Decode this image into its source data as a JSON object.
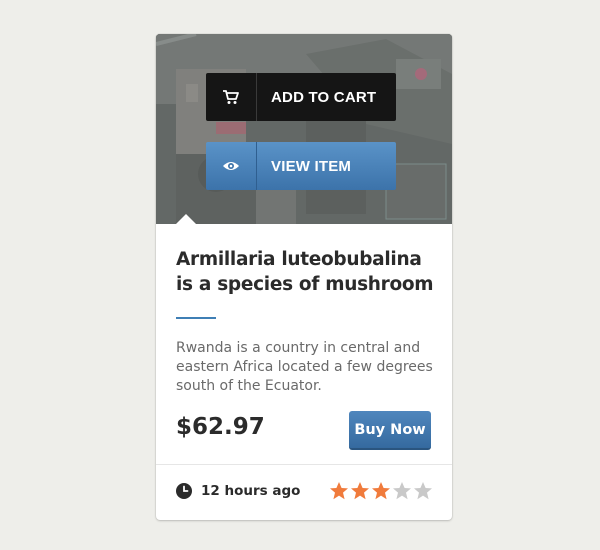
{
  "overlay_buttons": {
    "add_to_cart": {
      "label": "ADD TO CART",
      "icon": "cart-icon"
    },
    "view_item": {
      "label": "VIEW ITEM",
      "icon": "eye-icon"
    }
  },
  "product": {
    "title": "Armillaria luteobubalina is a species of mushroom",
    "description": "Rwanda is a country in central and eastern Africa located a few degrees south of the Ecuator.",
    "price": "$62.97",
    "buy_label": "Buy Now"
  },
  "footer": {
    "time_icon": "clock-icon",
    "time_text": "12 hours ago",
    "rating": 3,
    "rating_max": 5
  },
  "colors": {
    "accent": "#3f7fb5",
    "star_filled": "#f07b3c",
    "star_empty": "#c9c9c9"
  }
}
